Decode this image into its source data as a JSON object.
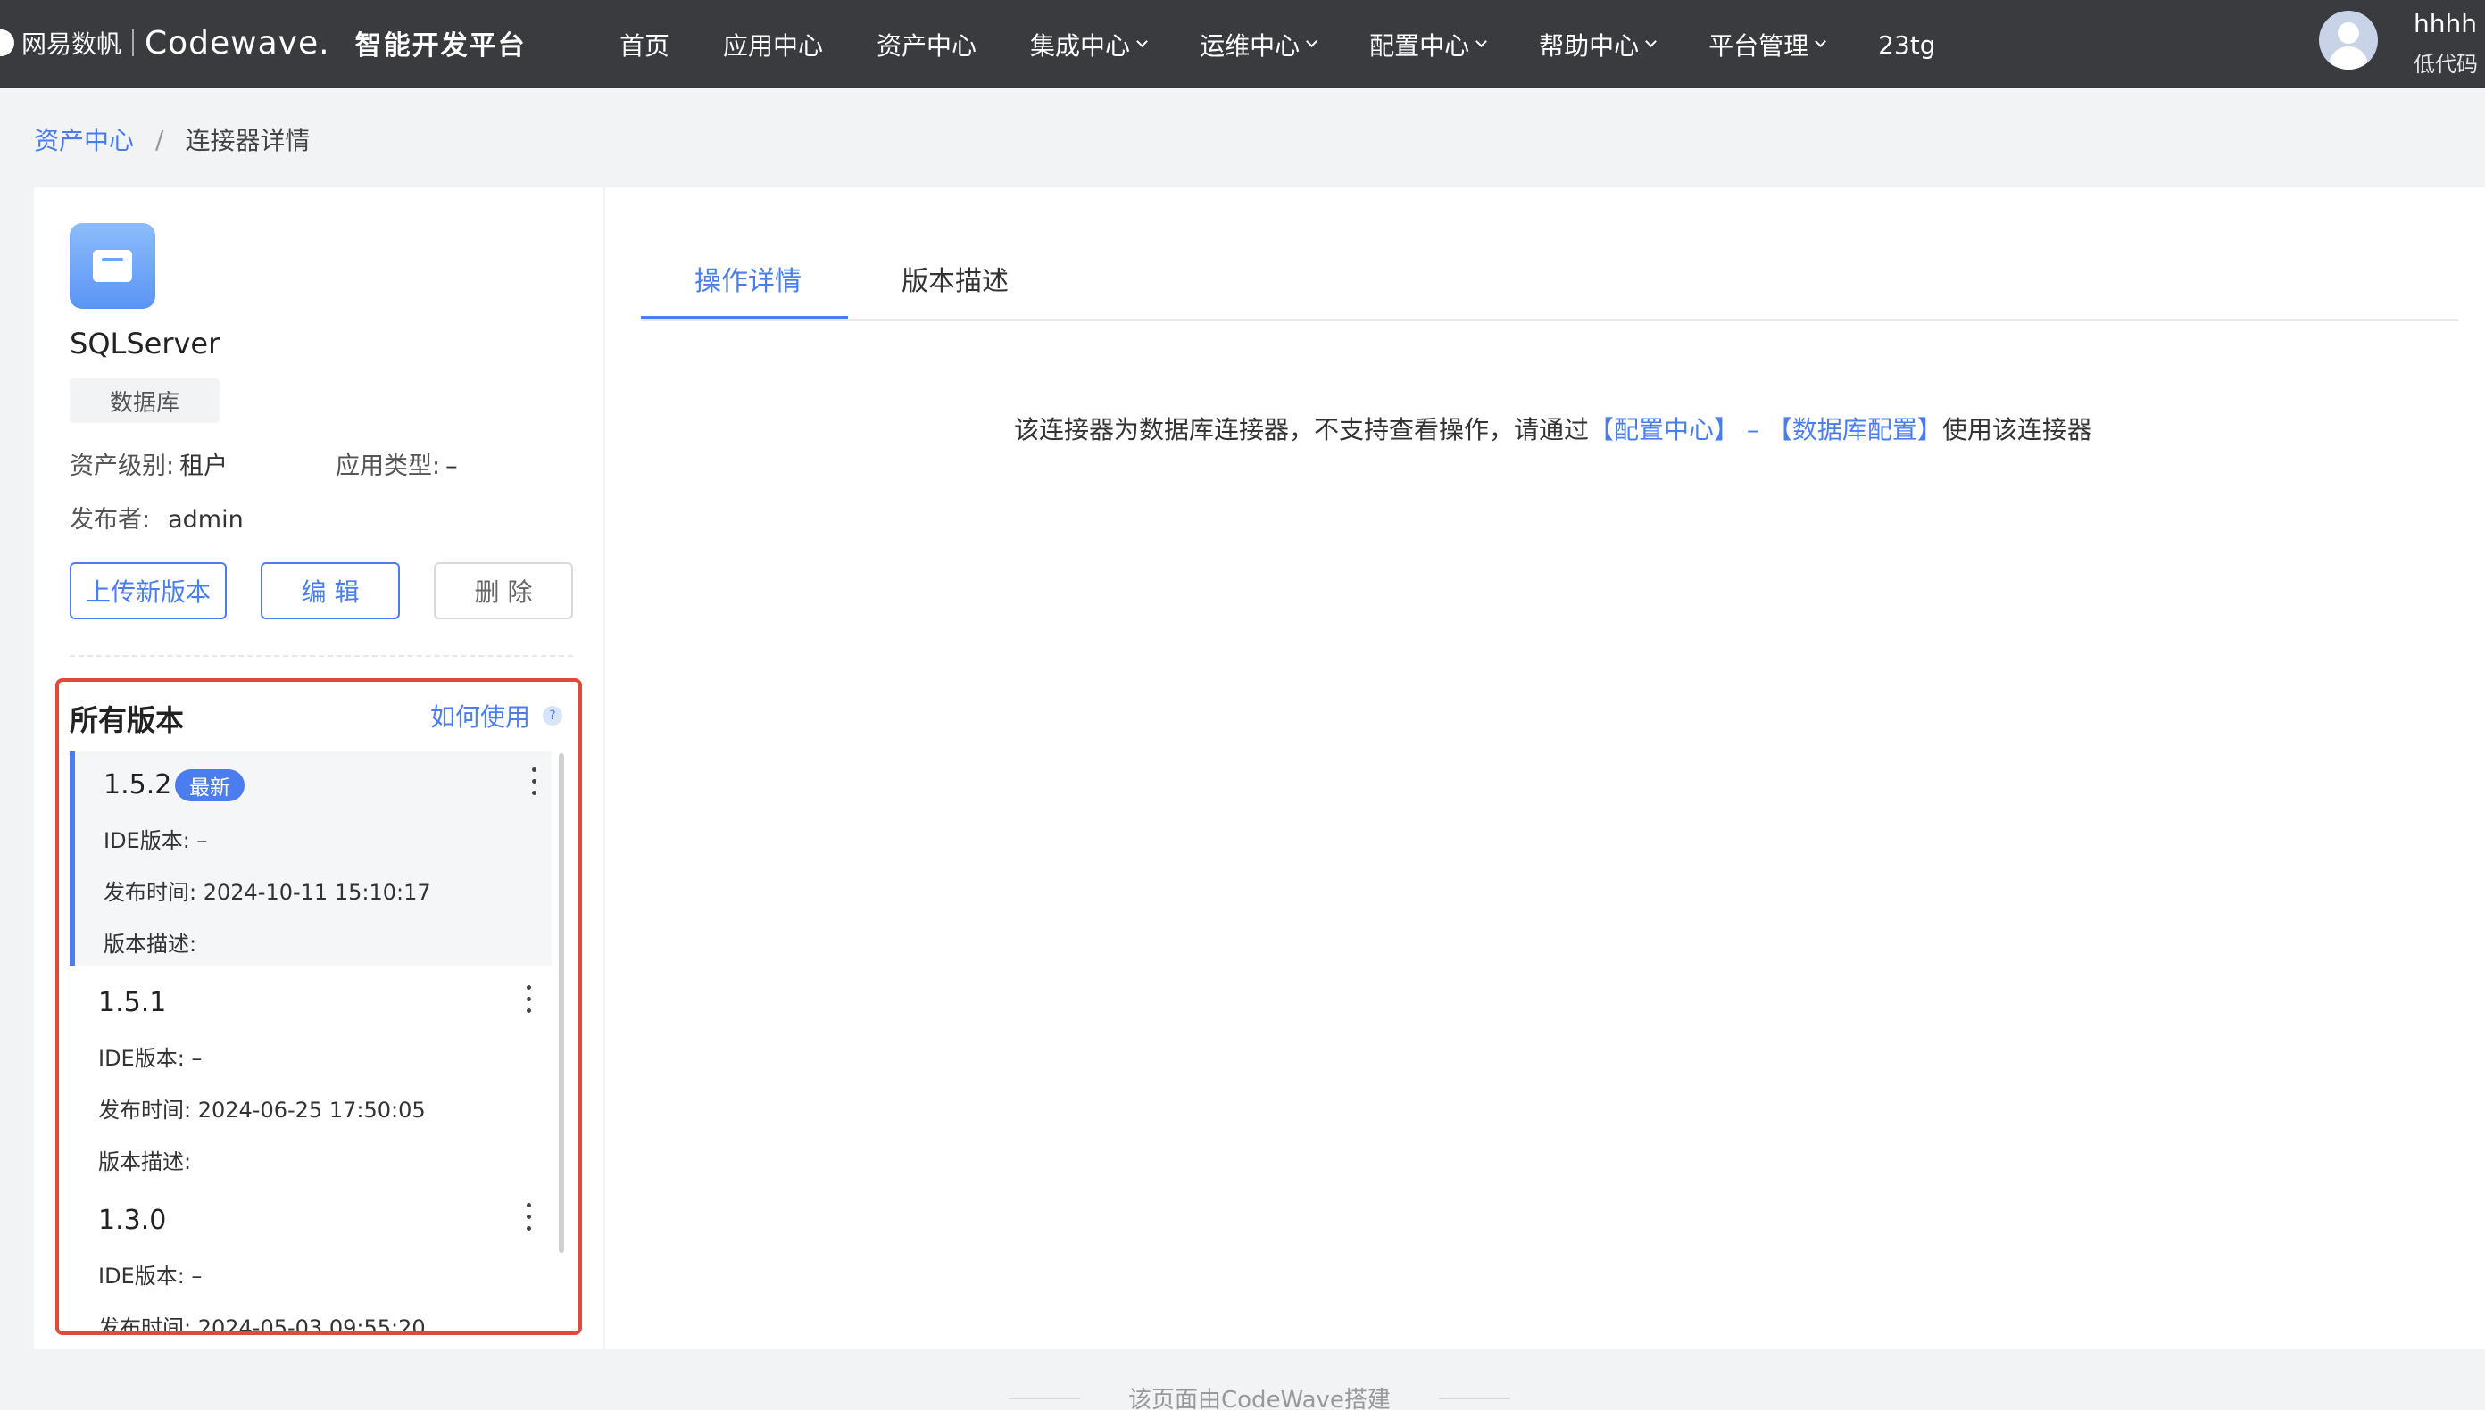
{
  "header": {
    "brand_netease": "网易数帆",
    "brand_codewave": "Codewave.",
    "brand_title": "智能开发平台",
    "nav": [
      "首页",
      "应用中心",
      "资产中心",
      "集成中心",
      "运维中心",
      "配置中心",
      "帮助中心",
      "平台管理",
      "23tg"
    ],
    "nav_dropdown": [
      false,
      false,
      false,
      true,
      true,
      true,
      true,
      true,
      false
    ],
    "user_name": "hhhh",
    "user_role": "低代码"
  },
  "breadcrumb": {
    "parent": "资产中心",
    "separator": "/",
    "current": "连接器详情"
  },
  "connector": {
    "name": "SQLServer",
    "type_tag": "数据库",
    "asset_level_label": "资产级别:",
    "asset_level_value": "租户",
    "app_type_label": "应用类型:",
    "app_type_value": "–",
    "publisher_label": "发布者:",
    "publisher_value": "admin"
  },
  "actions": {
    "upload": "上传新版本",
    "edit": "编 辑",
    "delete": "删 除"
  },
  "versions": {
    "title": "所有版本",
    "how_to_use": "如何使用",
    "help_icon": "?",
    "latest_badge": "最新",
    "items": [
      {
        "version": "1.5.2",
        "ide": "IDE版本: –",
        "published": "发布时间: 2024-10-11 15:10:17",
        "desc": "版本描述:",
        "latest": true
      },
      {
        "version": "1.5.1",
        "ide": "IDE版本: –",
        "published": "发布时间: 2024-06-25 17:50:05",
        "desc": "版本描述:",
        "latest": false
      },
      {
        "version": "1.3.0",
        "ide": "IDE版本: –",
        "published": "发布时间: 2024-05-03 09:55:20",
        "desc": "",
        "latest": false
      }
    ]
  },
  "tabs": {
    "ops": "操作详情",
    "desc": "版本描述"
  },
  "notice": {
    "prefix": "该连接器为数据库连接器，不支持查看操作，请通过",
    "link1": "【配置中心】",
    "dash": " – ",
    "link2": "【数据库配置】",
    "suffix": "使用该连接器"
  },
  "footer": {
    "text": "该页面由CodeWave搭建"
  },
  "colors": {
    "accent": "#4a7ef0",
    "topbar": "#3a3b3f",
    "highlight_border": "#e04a3a"
  }
}
